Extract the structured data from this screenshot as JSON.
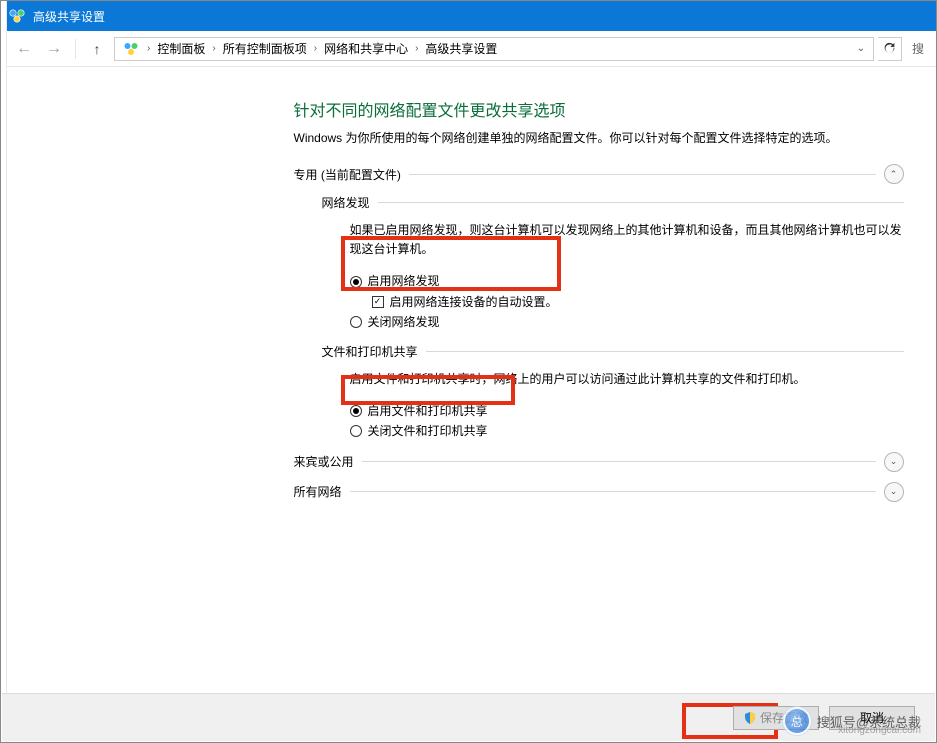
{
  "titlebar": {
    "title": "高级共享设置"
  },
  "breadcrumb": {
    "items": [
      "控制面板",
      "所有控制面板项",
      "网络和共享中心",
      "高级共享设置"
    ]
  },
  "search": {
    "placeholder": "搜"
  },
  "page": {
    "title": "针对不同的网络配置文件更改共享选项",
    "subtitle": "Windows 为你所使用的每个网络创建单独的网络配置文件。你可以针对每个配置文件选择特定的选项。"
  },
  "profiles": {
    "private": {
      "label": "专用 (当前配置文件)",
      "expanded": true,
      "network_discovery": {
        "label": "网络发现",
        "desc": "如果已启用网络发现，则这台计算机可以发现网络上的其他计算机和设备，而且其他网络计算机也可以发现这台计算机。",
        "opt_on": "启用网络发现",
        "opt_on_sub": "启用网络连接设备的自动设置。",
        "opt_off": "关闭网络发现",
        "selected": "on",
        "auto_setup_checked": true
      },
      "file_printer": {
        "label": "文件和打印机共享",
        "desc": "启用文件和打印机共享时，网络上的用户可以访问通过此计算机共享的文件和打印机。",
        "opt_on": "启用文件和打印机共享",
        "opt_off": "关闭文件和打印机共享",
        "selected": "on"
      }
    },
    "guest": {
      "label": "来宾或公用",
      "expanded": false
    },
    "all": {
      "label": "所有网络",
      "expanded": false
    }
  },
  "footer": {
    "save": "保存更改",
    "cancel": "取消"
  },
  "watermark": {
    "text": "搜狐号@系统总裁",
    "url": "xitongzongcai.com"
  }
}
